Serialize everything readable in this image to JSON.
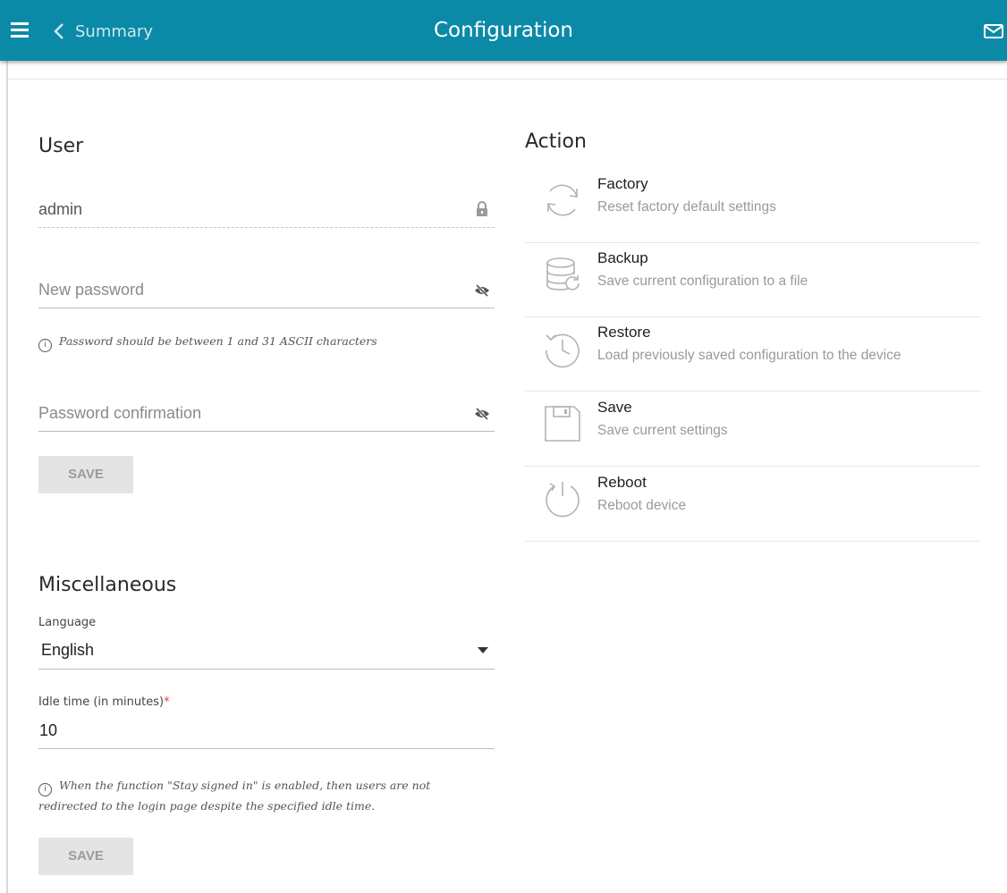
{
  "header": {
    "back_label": "Summary",
    "title": "Configuration",
    "accent_color": "#0b8aa8"
  },
  "user": {
    "title": "User",
    "username": "admin",
    "new_password_placeholder": "New password",
    "password_hint": "Password should be between 1 and 31 ASCII characters",
    "confirm_placeholder": "Password confirmation",
    "save_label": "SAVE"
  },
  "misc": {
    "title": "Miscellaneous",
    "language_label": "Language",
    "language_value": "English",
    "idle_label": "Idle time (in minutes)",
    "idle_required": "*",
    "idle_value": "10",
    "idle_hint_line1": "When the function \"Stay signed in\" is enabled, then users are not",
    "idle_hint_line2": "redirected to the login page despite the specified idle time.",
    "save_label": "SAVE"
  },
  "action": {
    "title": "Action",
    "items": [
      {
        "title": "Factory",
        "desc": "Reset factory default settings",
        "icon": "refresh-icon"
      },
      {
        "title": "Backup",
        "desc": "Save current configuration to a file",
        "icon": "database-backup-icon"
      },
      {
        "title": "Restore",
        "desc": "Load previously saved configuration to the device",
        "icon": "history-icon"
      },
      {
        "title": "Save",
        "desc": "Save current settings",
        "icon": "floppy-icon"
      },
      {
        "title": "Reboot",
        "desc": "Reboot device",
        "icon": "power-icon"
      }
    ]
  }
}
